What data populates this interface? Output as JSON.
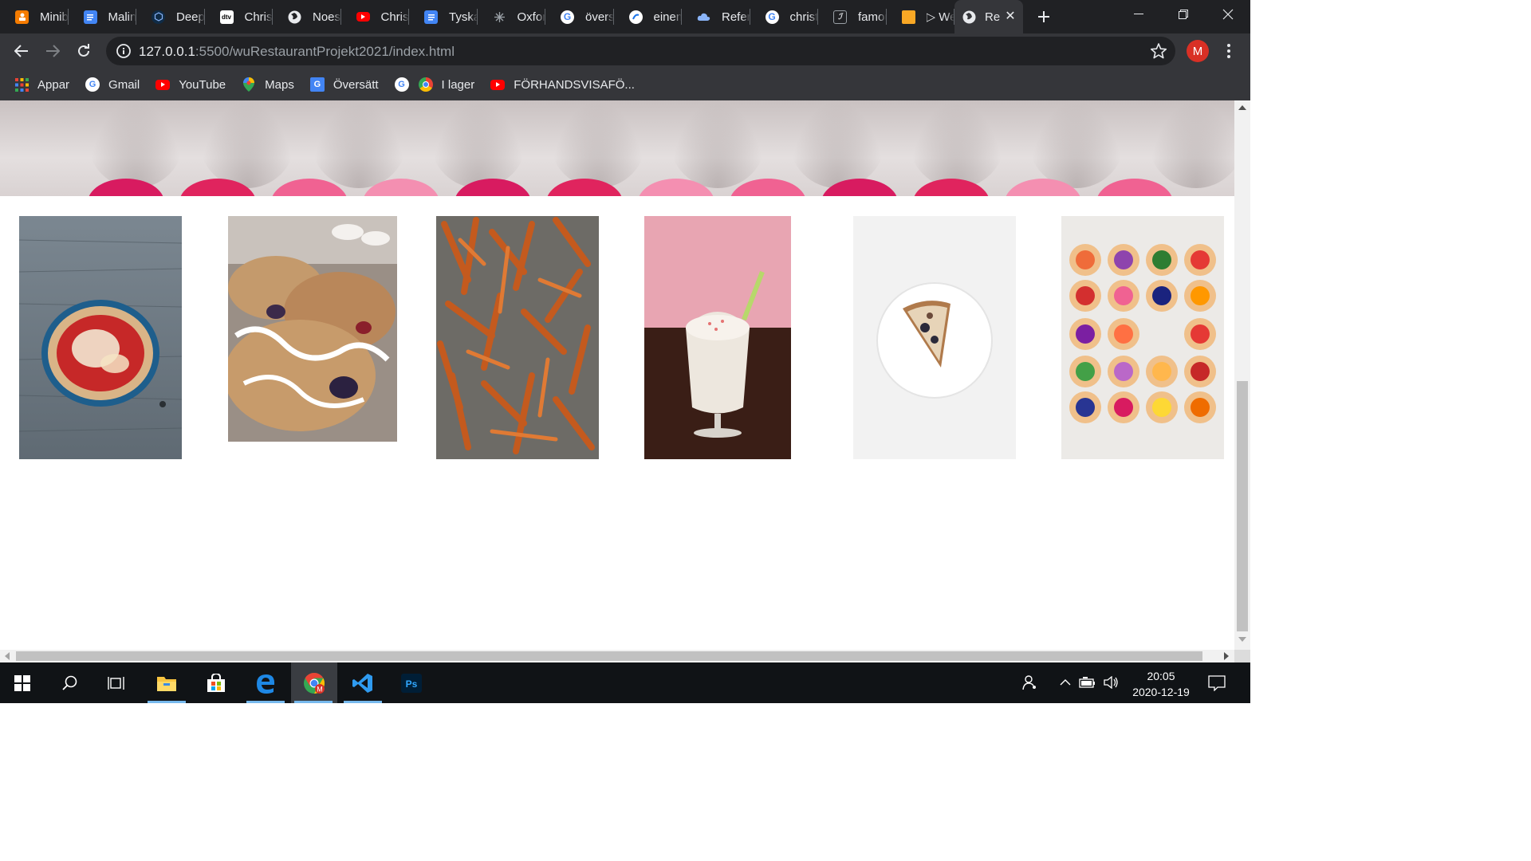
{
  "browser": {
    "tabs": [
      {
        "label": "Minib",
        "icon": "orange-app-icon",
        "color": "#f57c00"
      },
      {
        "label": "Malin",
        "icon": "google-docs-icon",
        "color": "#4285f4"
      },
      {
        "label": "Deepl",
        "icon": "deepl-icon",
        "color": "#0f2b46"
      },
      {
        "label": "Christ",
        "icon": "dtv-icon",
        "color": "#ffffff"
      },
      {
        "label": "Noest",
        "icon": "globe-icon",
        "color": "#ffffff"
      },
      {
        "label": "Christ",
        "icon": "youtube-icon",
        "color": "#ff0000"
      },
      {
        "label": "Tyska",
        "icon": "google-docs-icon",
        "color": "#4285f4"
      },
      {
        "label": "Oxfor",
        "icon": "oxford-icon",
        "color": "#9aa0a6"
      },
      {
        "label": "översi",
        "icon": "google-icon",
        "color": "#ffffff"
      },
      {
        "label": "einem",
        "icon": "app-icon",
        "color": "#ffffff"
      },
      {
        "label": "Refere",
        "icon": "cloud-icon",
        "color": "#8ab4f8"
      },
      {
        "label": "christ",
        "icon": "google-icon",
        "color": "#ffffff"
      },
      {
        "label": "famou",
        "icon": "document-icon",
        "color": "#9aa0a6"
      },
      {
        "label": "▷ We",
        "icon": "folder-icon",
        "color": "#f9a825"
      }
    ],
    "active_tab": {
      "label": "Re",
      "icon": "globe-icon"
    },
    "url_host": "127.0.0.1",
    "url_rest": ":5500/wuRestaurantProjekt2021/index.html",
    "profile_initial": "M",
    "bookmarks": [
      {
        "label": "Appar",
        "icon": "apps-grid-icon"
      },
      {
        "label": "Gmail",
        "icon": "google-icon"
      },
      {
        "label": "YouTube",
        "icon": "youtube-icon"
      },
      {
        "label": "Maps",
        "icon": "maps-pin-icon"
      },
      {
        "label": "Översätt",
        "icon": "translate-icon"
      },
      {
        "label": "",
        "icon": "google-icon"
      },
      {
        "label": "I lager",
        "icon": "chrome-icon"
      },
      {
        "label": "FÖRHANDSVISAFÖ...",
        "icon": "youtube-icon"
      }
    ]
  },
  "page": {
    "gallery": [
      {
        "name": "pasta-bowl-image"
      },
      {
        "name": "pastry-image"
      },
      {
        "name": "sweet-potato-fries-image"
      },
      {
        "name": "milkshake-image"
      },
      {
        "name": "pizza-slice-image"
      },
      {
        "name": "fruit-tarts-image"
      }
    ]
  },
  "taskbar": {
    "time": "20:05",
    "date": "2020-12-19"
  },
  "colors": {
    "chrome_dark": "#202124",
    "chrome_toolbar": "#35363a",
    "accent_red": "#d93025",
    "taskbar": "#101316"
  }
}
